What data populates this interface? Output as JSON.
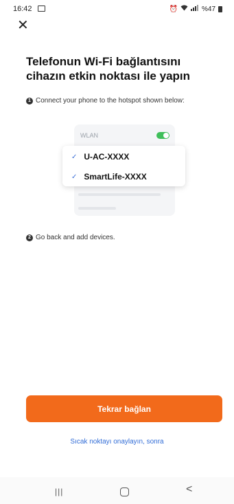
{
  "status_bar": {
    "time": "16:42",
    "battery": "%47",
    "icons": [
      "gallery-icon",
      "alarm-icon",
      "wifi-icon",
      "volte-icon",
      "signal-icon",
      "battery-icon"
    ]
  },
  "close_icon_glyph": "✕",
  "title": "Telefonun Wi-Fi bağlantısını cihazın etkin noktası ile yapın",
  "steps": [
    {
      "number": "1",
      "text": "Connect your phone to the hotspot shown below:"
    },
    {
      "number": "2",
      "text": "Go back and add devices."
    }
  ],
  "illustration": {
    "wlan_label": "WLAN",
    "toggle_on": true,
    "networks": [
      "U-AC-XXXX",
      "SmartLife-XXXX"
    ]
  },
  "primary_button": "Tekrar bağlan",
  "link": "Sıcak noktayı onaylayın, sonra",
  "colors": {
    "accent": "#f26a1b",
    "link": "#2f6bd6",
    "toggle": "#3fbf5a"
  },
  "nav": {
    "recents_glyph": "|||",
    "back_glyph": "<"
  }
}
